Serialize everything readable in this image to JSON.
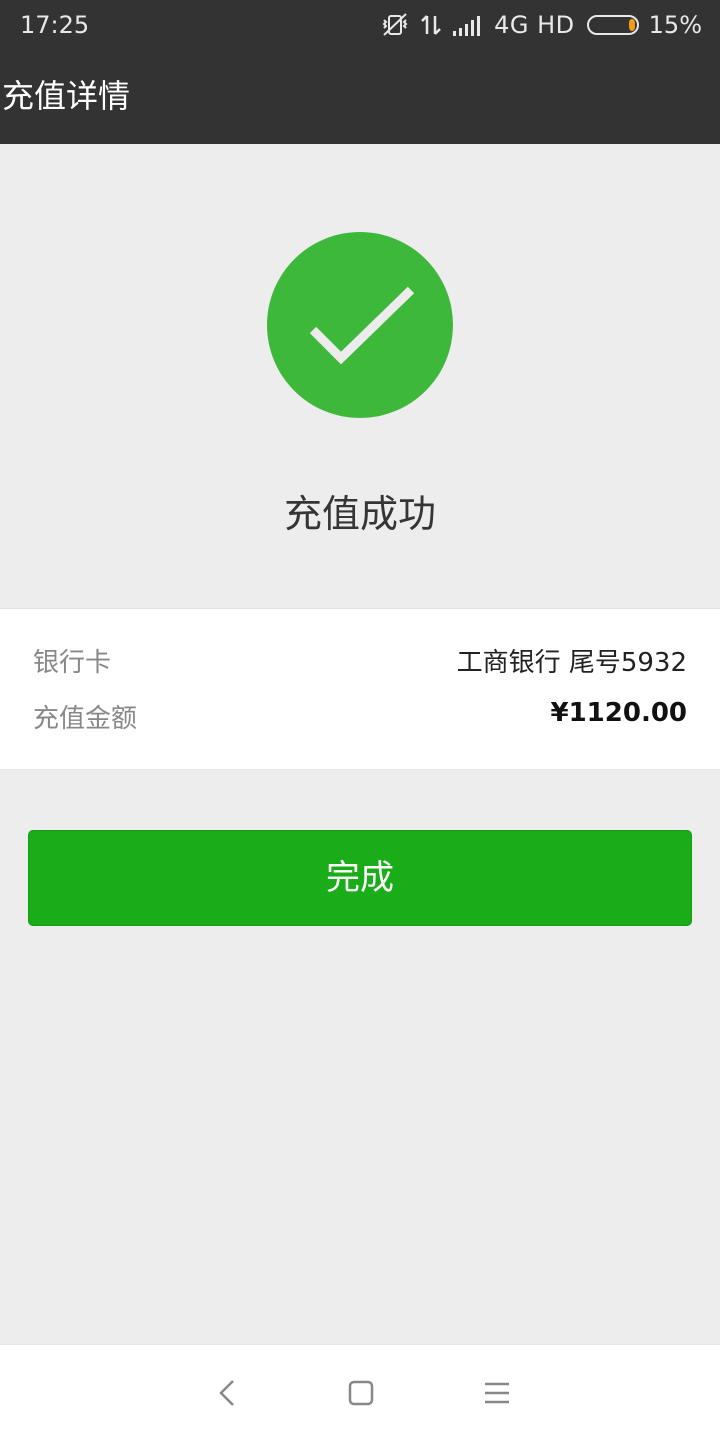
{
  "status_bar": {
    "time": "17:25",
    "network_label": "4G HD",
    "battery_percent": "15%",
    "battery_level": 0.15,
    "icons": [
      "vibrate-off-icon",
      "data-transfer-icon",
      "signal-bars-icon",
      "battery-icon"
    ]
  },
  "header": {
    "title": "充值详情"
  },
  "result": {
    "icon": "checkmark-icon",
    "title": "充值成功"
  },
  "details": {
    "bank_label": "银行卡",
    "bank_value": "工商银行 尾号5932",
    "amount_label": "充值金额",
    "amount_value": "¥1120.00"
  },
  "actions": {
    "done_label": "完成"
  },
  "nav_bar": {
    "icons": [
      "back-icon",
      "home-icon",
      "menu-icon"
    ]
  },
  "colors": {
    "header_bg": "#333333",
    "page_bg": "#ededed",
    "success_green": "#3db83a",
    "button_green": "#1aad19",
    "battery_orange": "#f39c12"
  }
}
